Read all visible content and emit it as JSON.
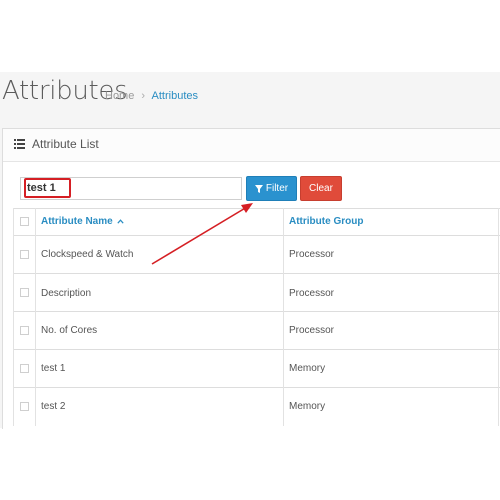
{
  "header": {
    "title": "Attributes",
    "breadcrumb": [
      {
        "label": "Home"
      },
      {
        "label": "Attributes"
      }
    ],
    "breadcrumb_sep": "›"
  },
  "panel": {
    "title": "Attribute List",
    "icon": "list-icon"
  },
  "filter": {
    "value": "test 1",
    "filter_label": "Filter",
    "clear_label": "Clear"
  },
  "table": {
    "columns": [
      {
        "label": "Attribute Name",
        "sort": "asc"
      },
      {
        "label": "Attribute Group"
      }
    ],
    "rows": [
      {
        "name": "Clockspeed & Watch",
        "group": "Processor"
      },
      {
        "name": "Description",
        "group": "Processor"
      },
      {
        "name": "No. of Cores",
        "group": "Processor"
      },
      {
        "name": "test 1",
        "group": "Memory"
      },
      {
        "name": "test 2",
        "group": "Memory"
      }
    ]
  },
  "colors": {
    "link": "#2a8dc2",
    "filter_btn": "#2a92cf",
    "clear_btn": "#e04b3a",
    "highlight": "#d51f24"
  }
}
